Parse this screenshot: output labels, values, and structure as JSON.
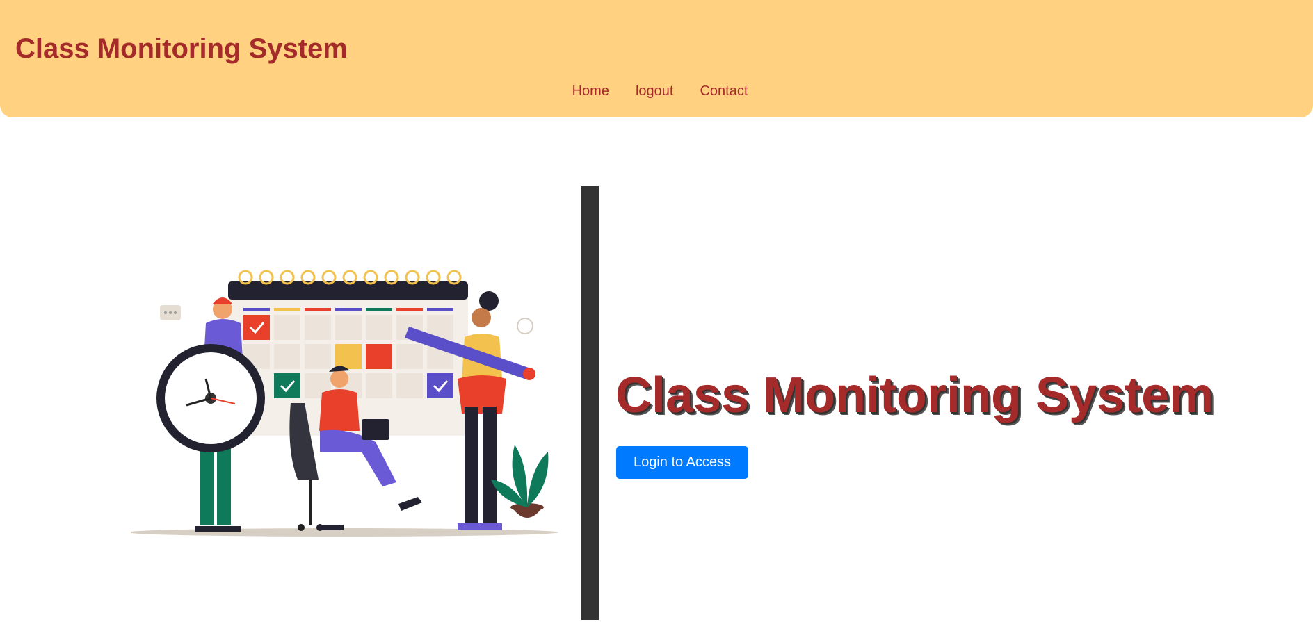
{
  "header": {
    "brand": "Class Monitoring System",
    "nav": [
      {
        "label": "Home"
      },
      {
        "label": "logout"
      },
      {
        "label": "Contact"
      }
    ]
  },
  "hero": {
    "title": "Class Monitoring System",
    "login_label": "Login to Access",
    "illustration": "class-schedule-illustration"
  },
  "colors": {
    "header_bg": "#ffd180",
    "brand_text": "#a52a2a",
    "divider": "#333333",
    "button_bg": "#007bff",
    "button_text": "#ffffff"
  }
}
